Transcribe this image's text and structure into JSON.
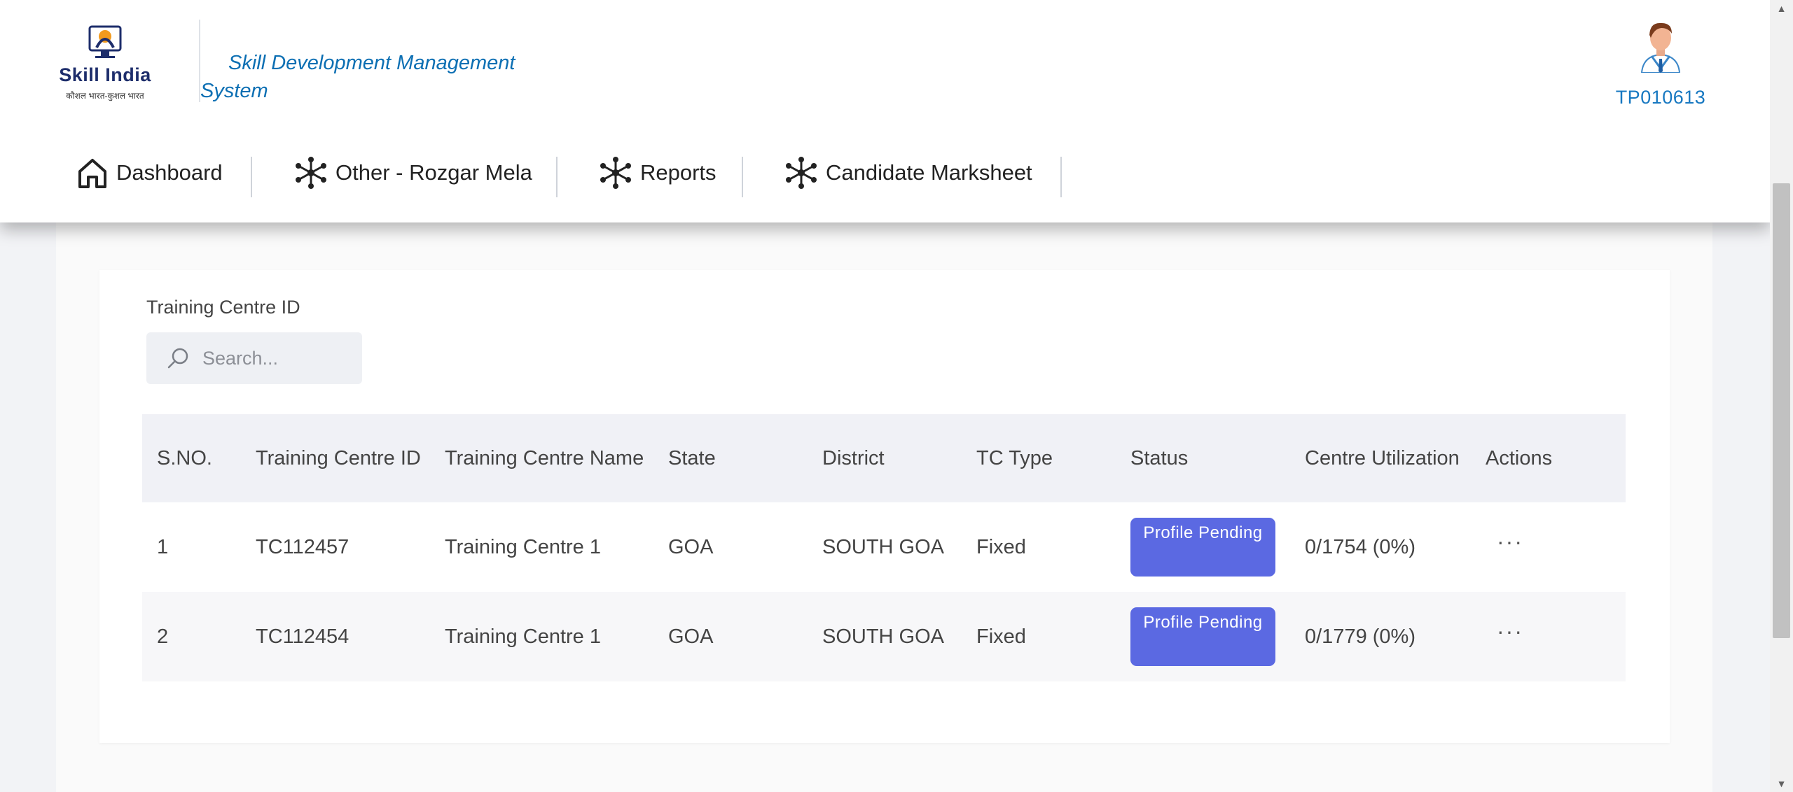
{
  "header": {
    "logo": {
      "brand": "Skill India",
      "tagline": "कौशल भारत-कुशल भारत"
    },
    "system_title": "Skill Development Management System",
    "user_id": "TP010613"
  },
  "nav": {
    "items": [
      {
        "label": "Dashboard",
        "icon": "home-icon"
      },
      {
        "label": "Other - Rozgar Mela",
        "icon": "network-icon"
      },
      {
        "label": "Reports",
        "icon": "network-icon"
      },
      {
        "label": "Candidate Marksheet",
        "icon": "network-icon"
      }
    ]
  },
  "filter": {
    "label": "Training Centre ID",
    "search_placeholder": "Search...",
    "search_value": ""
  },
  "table": {
    "headers": [
      "S.NO.",
      "Training Centre ID",
      "Training Centre Name",
      "State",
      "District",
      "TC Type",
      "Status",
      "Centre Utilization",
      "Actions"
    ],
    "rows": [
      {
        "sno": "1",
        "tc_id": "TC112457",
        "tc_name": "Training Centre 1",
        "state": "GOA",
        "district": "SOUTH GOA",
        "tc_type": "Fixed",
        "status": "Profile Pending",
        "utilization": "0/1754 (0%)",
        "actions": "···"
      },
      {
        "sno": "2",
        "tc_id": "TC112454",
        "tc_name": "Training Centre 1",
        "state": "GOA",
        "district": "SOUTH GOA",
        "tc_type": "Fixed",
        "status": "Profile Pending",
        "utilization": "0/1779 (0%)",
        "actions": "···"
      }
    ]
  },
  "colors": {
    "accent": "#5b69e2",
    "title_blue": "#0c6fb3",
    "user_blue": "#1778c1",
    "header_bg": "#ffffff",
    "table_header_bg": "#f0f1f6"
  }
}
